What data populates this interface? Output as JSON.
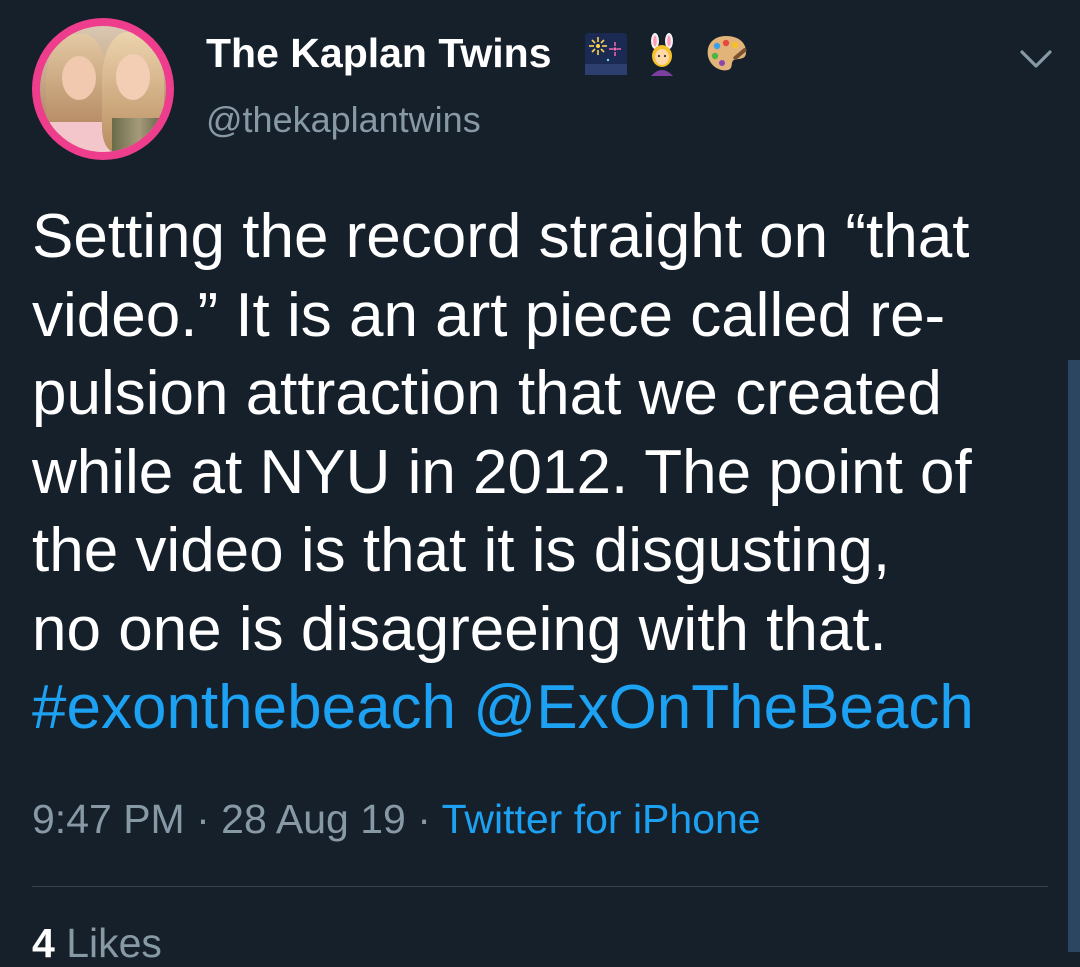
{
  "tweet": {
    "author": {
      "display_name": "The Kaplan Twins",
      "username": "@thekaplantwins",
      "name_emojis": [
        "fireworks-icon",
        "woman-with-bunny-ears-icon",
        "artist-palette-icon"
      ]
    },
    "text_lines": [
      "Setting the record straight on “that",
      "video.” It is an art piece called re-",
      "pulsion attraction that we created",
      "while at NYU in 2012. The point of",
      "the video is that it is disgusting,",
      "no one is disagreeing with that."
    ],
    "hashtag": "#exonthebeach",
    "mention": "@ExOnTheBeach",
    "time": "9:47 PM",
    "separator": "·",
    "date": "28 Aug 19",
    "source": "Twitter for iPhone",
    "likes_count": "4",
    "likes_label": "Likes"
  },
  "colors": {
    "background": "#15202b",
    "text": "#ffffff",
    "secondary": "#8899a6",
    "link": "#1da1f2",
    "divider": "#38444d",
    "avatar_ring": "#ee3d8d"
  }
}
